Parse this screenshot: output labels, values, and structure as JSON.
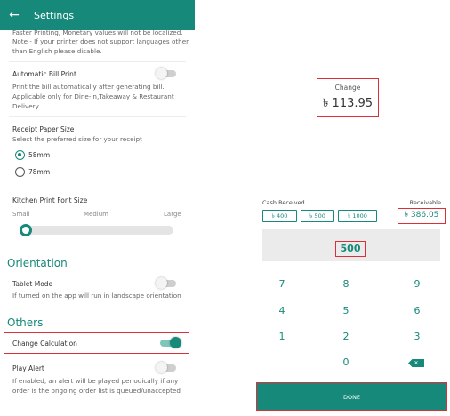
{
  "settings": {
    "title": "Settings",
    "truncated_lines": [
      "Faster Printing, Monetary values will not be localized.",
      "Note - If your printer does not support languages other",
      "than English please disable."
    ],
    "auto_bill_print": {
      "label": "Automatic Bill Print",
      "desc": [
        "Print the bill automatically after generating bill.",
        "Applicable only for Dine-in,Takeaway & Restaurant",
        "Delivery"
      ],
      "enabled": false
    },
    "receipt_paper": {
      "label": "Receipt Paper Size",
      "desc": "Select the preferred size for your receipt",
      "options": [
        "58mm",
        "78mm"
      ],
      "selected": "58mm"
    },
    "kitchen_font": {
      "label": "Kitchen Print Font Size",
      "sizes": [
        "Small",
        "Medium",
        "Large"
      ],
      "selected": "Small"
    },
    "orientation_section": "Orientation",
    "tablet_mode": {
      "label": "Tablet Mode",
      "desc": "If turned on the app will run in landscape orientation",
      "enabled": false
    },
    "others_section": "Others",
    "change_calculation": {
      "label": "Change Calculation",
      "enabled": true
    },
    "play_alert": {
      "label": "Play Alert",
      "desc": [
        "If enabled, an alert will be played periodically if any",
        "order is the ongoing order list is queued/unaccepted"
      ],
      "enabled": false
    },
    "colors": {
      "accent": "#16897a",
      "highlight": "#d9303a"
    }
  },
  "calculator": {
    "change_label": "Change",
    "change_amount": "৳ 113.95",
    "cash_received_label": "Cash Received",
    "quick_amounts": [
      "৳ 400",
      "৳ 500",
      "৳ 1000"
    ],
    "receivable_label": "Receivable",
    "receivable_amount": "৳ 386.05",
    "entered_amount": "500",
    "keys": [
      "7",
      "8",
      "9",
      "4",
      "5",
      "6",
      "1",
      "2",
      "3",
      "0"
    ],
    "backspace_icon": "backspace-icon",
    "done_label": "DONE"
  }
}
